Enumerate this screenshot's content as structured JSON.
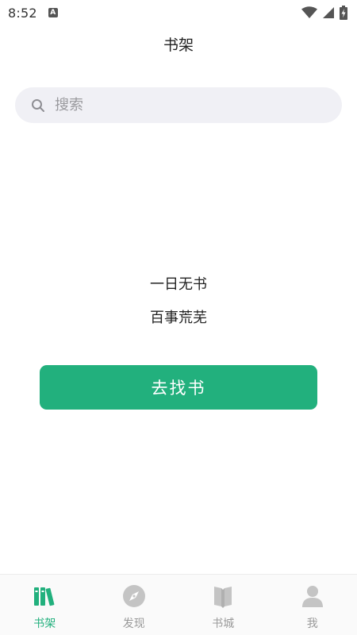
{
  "status_bar": {
    "time": "8:52",
    "app_icon_letter": "A",
    "icons": [
      "wifi-icon",
      "signal-icon",
      "battery-icon"
    ]
  },
  "header": {
    "title": "书架"
  },
  "search": {
    "placeholder": "搜索",
    "value": "",
    "icon": "search-icon"
  },
  "empty_state": {
    "line1": "一日无书",
    "line2": "百事荒芜",
    "button_label": "去找书"
  },
  "bottom_nav": {
    "items": [
      {
        "label": "书架",
        "icon": "bookshelf-icon",
        "active": true
      },
      {
        "label": "发现",
        "icon": "compass-icon",
        "active": false
      },
      {
        "label": "书城",
        "icon": "book-icon",
        "active": false
      },
      {
        "label": "我",
        "icon": "person-icon",
        "active": false
      }
    ]
  },
  "colors": {
    "accent": "#22b07d",
    "search_bg": "#f0f0f5",
    "inactive": "#c4c4c4"
  }
}
